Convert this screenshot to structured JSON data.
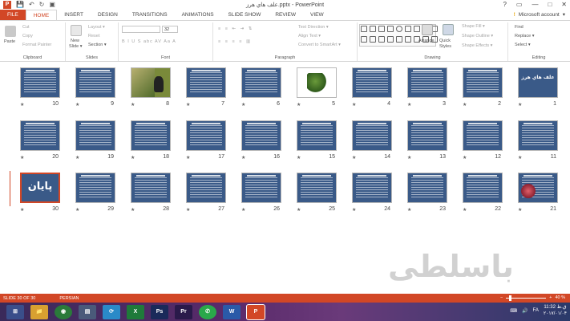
{
  "window": {
    "title": "علف هاي هرز.pptx - PowerPoint",
    "controls": [
      "?",
      "▭",
      "—",
      "□",
      "✕"
    ]
  },
  "qat": {
    "save": "💾",
    "undo": "↶",
    "redo": "↻",
    "start": "▣"
  },
  "tabs": [
    "FILE",
    "HOME",
    "INSERT",
    "DESIGN",
    "TRANSITIONS",
    "ANIMATIONS",
    "SLIDE SHOW",
    "REVIEW",
    "VIEW"
  ],
  "active_tab": "HOME",
  "account": {
    "warning": "!",
    "label": "Microsoft account",
    "chevron": "▾"
  },
  "ribbon": {
    "clipboard": {
      "label": "Clipboard",
      "paste": "Paste",
      "cut": "Cut",
      "copy": "Copy",
      "format_painter": "Format Painter"
    },
    "slides": {
      "label": "Slides",
      "new_slide": "New",
      "new_slide2": "Slide ▾",
      "layout": "Layout ▾",
      "reset": "Reset",
      "section": "Section ▾"
    },
    "font": {
      "label": "Font",
      "size": "32",
      "buttons": "B I U S abc AV Aa A"
    },
    "paragraph": {
      "label": "Paragraph",
      "text_direction": "Text Direction ▾",
      "align_text": "Align Text ▾",
      "smartart": "Convert to SmartArt ▾"
    },
    "drawing": {
      "label": "Drawing",
      "arrange": "Arrange",
      "quick_styles": "Quick Styles",
      "shape_fill": "Shape Fill ▾",
      "shape_outline": "Shape Outline ▾",
      "shape_effects": "Shape Effects ▾"
    },
    "editing": {
      "label": "Editing",
      "find": "Find",
      "replace": "Replace ▾",
      "select": "Select ▾"
    }
  },
  "slides_text": {
    "s1": "علف هاي هرز",
    "s30": "پایان"
  },
  "slides": [
    {
      "num": "1"
    },
    {
      "num": "2"
    },
    {
      "num": "3"
    },
    {
      "num": "4"
    },
    {
      "num": "5"
    },
    {
      "num": "6"
    },
    {
      "num": "7"
    },
    {
      "num": "8"
    },
    {
      "num": "9"
    },
    {
      "num": "10"
    },
    {
      "num": "11"
    },
    {
      "num": "12"
    },
    {
      "num": "13"
    },
    {
      "num": "14"
    },
    {
      "num": "15"
    },
    {
      "num": "16"
    },
    {
      "num": "17"
    },
    {
      "num": "18"
    },
    {
      "num": "19"
    },
    {
      "num": "20"
    },
    {
      "num": "21"
    },
    {
      "num": "22"
    },
    {
      "num": "23"
    },
    {
      "num": "24"
    },
    {
      "num": "25"
    },
    {
      "num": "26"
    },
    {
      "num": "27"
    },
    {
      "num": "28"
    },
    {
      "num": "29"
    },
    {
      "num": "30"
    }
  ],
  "star": "★",
  "watermark": "باسلطی",
  "status": {
    "slide": "SLIDE 30 OF 30",
    "language": "PERSIAN",
    "zoom": "40 %",
    "zoom_level": 40
  },
  "taskbar": {
    "apps": [
      "📁",
      "◉",
      "▤",
      "⟳",
      "X",
      "Ps",
      "Pr",
      "✆",
      "W",
      "P"
    ],
    "lang": "FA",
    "time": "11:32 ق.ظ",
    "date": "۲۰۱۷/۰۱/۰۴"
  },
  "colors": {
    "accent": "#d24726",
    "slide_bg": "#3a5a88"
  }
}
